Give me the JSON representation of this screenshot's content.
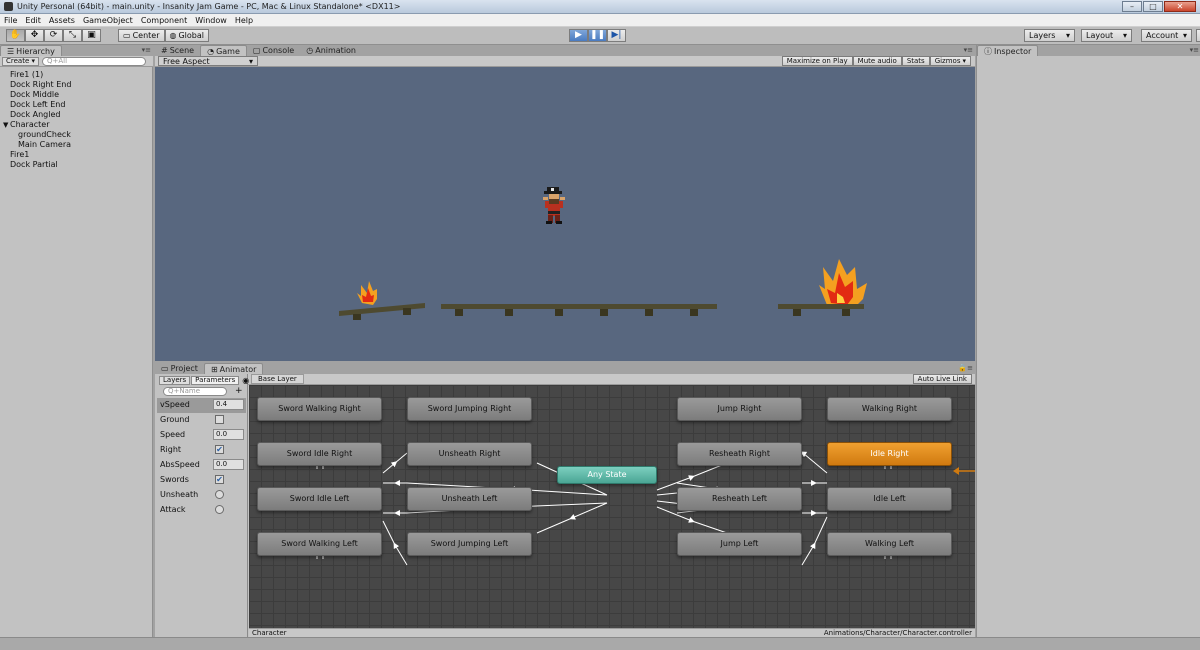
{
  "window": {
    "title": "Unity Personal (64bit) - main.unity - Insanity Jam Game - PC, Mac & Linux Standalone* <DX11>"
  },
  "menu": [
    "File",
    "Edit",
    "Assets",
    "GameObject",
    "Component",
    "Window",
    "Help"
  ],
  "toolbar": {
    "pivot_label": "Center",
    "space_label": "Global",
    "layers_label": "Layers",
    "layout_label": "Layout",
    "account_label": "Account"
  },
  "hierarchy": {
    "tab_label": "Hierarchy",
    "create_label": "Create",
    "search_placeholder": "Q+All",
    "items": [
      "Fire1 (1)",
      "Dock Right End",
      "Dock Middle",
      "Dock Left End",
      "Dock Angled",
      "Character",
      "groundCheck",
      "Main Camera",
      "Fire1",
      "Dock Partial"
    ]
  },
  "game_view": {
    "tabs": [
      "Scene",
      "Game",
      "Console",
      "Animation"
    ],
    "aspect_label": "Free Aspect",
    "options": [
      "Maximize on Play",
      "Mute audio",
      "Stats",
      "Gizmos"
    ]
  },
  "inspector": {
    "tab_label": "Inspector"
  },
  "animator": {
    "tabs": [
      "Project",
      "Animator"
    ],
    "subtabs": [
      "Layers",
      "Parameters"
    ],
    "search_placeholder": "Q+Name",
    "layer_label": "Base Layer",
    "auto_live_label": "Auto Live Link",
    "parameters": [
      {
        "name": "vSpeed",
        "type": "float",
        "value": "0.4"
      },
      {
        "name": "Ground",
        "type": "bool",
        "value": ""
      },
      {
        "name": "Speed",
        "type": "float",
        "value": "0.0"
      },
      {
        "name": "Right",
        "type": "bool",
        "value": "✔"
      },
      {
        "name": "AbsSpeed",
        "type": "float",
        "value": "0.0"
      },
      {
        "name": "Swords",
        "type": "bool",
        "value": "✔"
      },
      {
        "name": "Unsheath",
        "type": "trigger",
        "value": ""
      },
      {
        "name": "Attack",
        "type": "trigger",
        "value": ""
      }
    ],
    "states": {
      "sword_walking_right": "Sword Walking Right",
      "sword_jumping_right": "Sword Jumping Right",
      "jump_right": "Jump Right",
      "walking_right": "Walking Right",
      "sword_idle_right": "Sword Idle Right",
      "unsheath_right": "Unsheath Right",
      "resheath_right": "Resheath Right",
      "idle_right": "Idle Right",
      "any_state": "Any State",
      "sword_idle_left": "Sword Idle Left",
      "unsheath_left": "Unsheath Left",
      "resheath_left": "Resheath Left",
      "idle_left": "Idle Left",
      "sword_walking_left": "Sword Walking Left",
      "sword_jumping_left": "Sword Jumping Left",
      "jump_left": "Jump Left",
      "walking_left": "Walking Left"
    },
    "footer_left": "Character",
    "footer_right": "Animations/Character/Character.controller"
  },
  "colors": {
    "game_bg": "#58677f",
    "default_state": "#e08a1c",
    "any_state": "#5fb8a6"
  }
}
